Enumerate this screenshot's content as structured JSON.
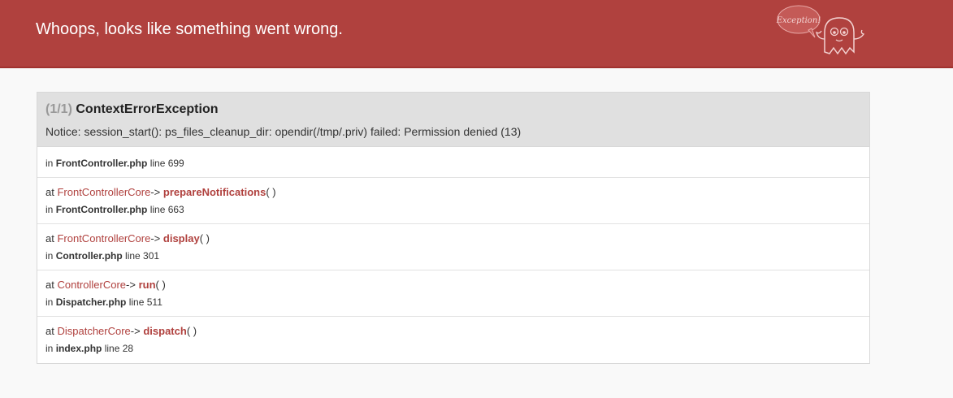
{
  "header": {
    "title": "Whoops, looks like something went wrong.",
    "logo_icon": "ghost-exception-icon",
    "logo_text": "Exception!",
    "bg_color": "#b0413e"
  },
  "exception": {
    "count": "(1/1)",
    "name": "ContextErrorException",
    "message": "Notice: session_start(): ps_files_cleanup_dir: opendir(/tmp/.priv) failed: Permission denied (13)"
  },
  "trace": [
    {
      "in_prefix": "in",
      "file": "FrontController.php",
      "line_text": "line 699"
    },
    {
      "at_prefix": "at",
      "class": "FrontControllerCore",
      "arrow": "->",
      "method": "prepareNotifications",
      "parens": "( )",
      "in_prefix": "in",
      "file": "FrontController.php",
      "line_text": "line 663"
    },
    {
      "at_prefix": "at",
      "class": "FrontControllerCore",
      "arrow": "->",
      "method": "display",
      "parens": "( )",
      "in_prefix": "in",
      "file": "Controller.php",
      "line_text": "line 301"
    },
    {
      "at_prefix": "at",
      "class": "ControllerCore",
      "arrow": "->",
      "method": "run",
      "parens": "( )",
      "in_prefix": "in",
      "file": "Dispatcher.php",
      "line_text": "line 511"
    },
    {
      "at_prefix": "at",
      "class": "DispatcherCore",
      "arrow": "->",
      "method": "dispatch",
      "parens": "( )",
      "in_prefix": "in",
      "file": "index.php",
      "line_text": "line 28"
    }
  ]
}
